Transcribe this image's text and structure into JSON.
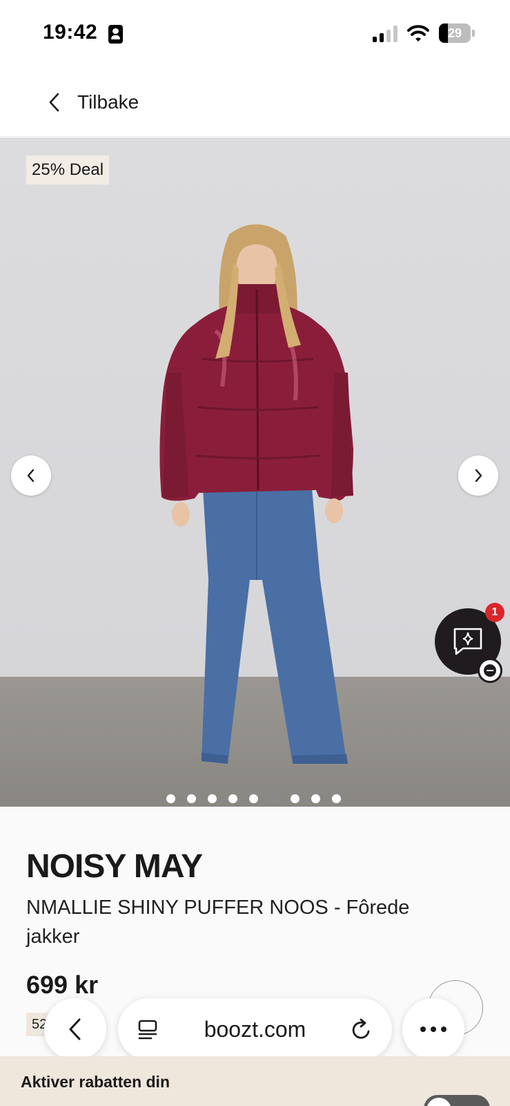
{
  "status_bar": {
    "time": "19:42",
    "battery_level": "29",
    "battery_fraction": 0.29,
    "signal_bars_active": 2,
    "icons": [
      "contact-card-icon",
      "signal-icon",
      "wifi-icon",
      "battery-icon"
    ]
  },
  "header": {
    "back_label": "Tilbake",
    "back_icon": "chevron-left-icon"
  },
  "gallery": {
    "deal_badge": "25% Deal",
    "image_alt": "Model in burgundy shiny puffer jacket and wide-leg blue jeans",
    "dot_count": 9,
    "active_dot": 6,
    "prev_icon": "chevron-left-icon",
    "next_icon": "chevron-right-icon"
  },
  "chat": {
    "badge_count": "1",
    "icon": "chat-sparkle-icon",
    "minimize_icon": "minus-circle-icon"
  },
  "product": {
    "brand": "NOISY MAY",
    "name": "NMALLIE SHINY PUFFER NOOS - Fôrede jakker",
    "price": "699 kr",
    "price_badge": "52 D"
  },
  "browser": {
    "url": "boozt.com",
    "back_icon": "chevron-left-icon",
    "tabs_icon": "tabs-icon",
    "reload_icon": "reload-icon",
    "more_icon": "more-icon"
  },
  "discount": {
    "label": "Aktiver rabatten din"
  },
  "colors": {
    "jacket": "#8a1e3a",
    "jeans": "#4a6fa5",
    "chat_bg": "#1f1b1f",
    "badge_red": "#d9262b",
    "banner_bg": "#efe6dc"
  }
}
